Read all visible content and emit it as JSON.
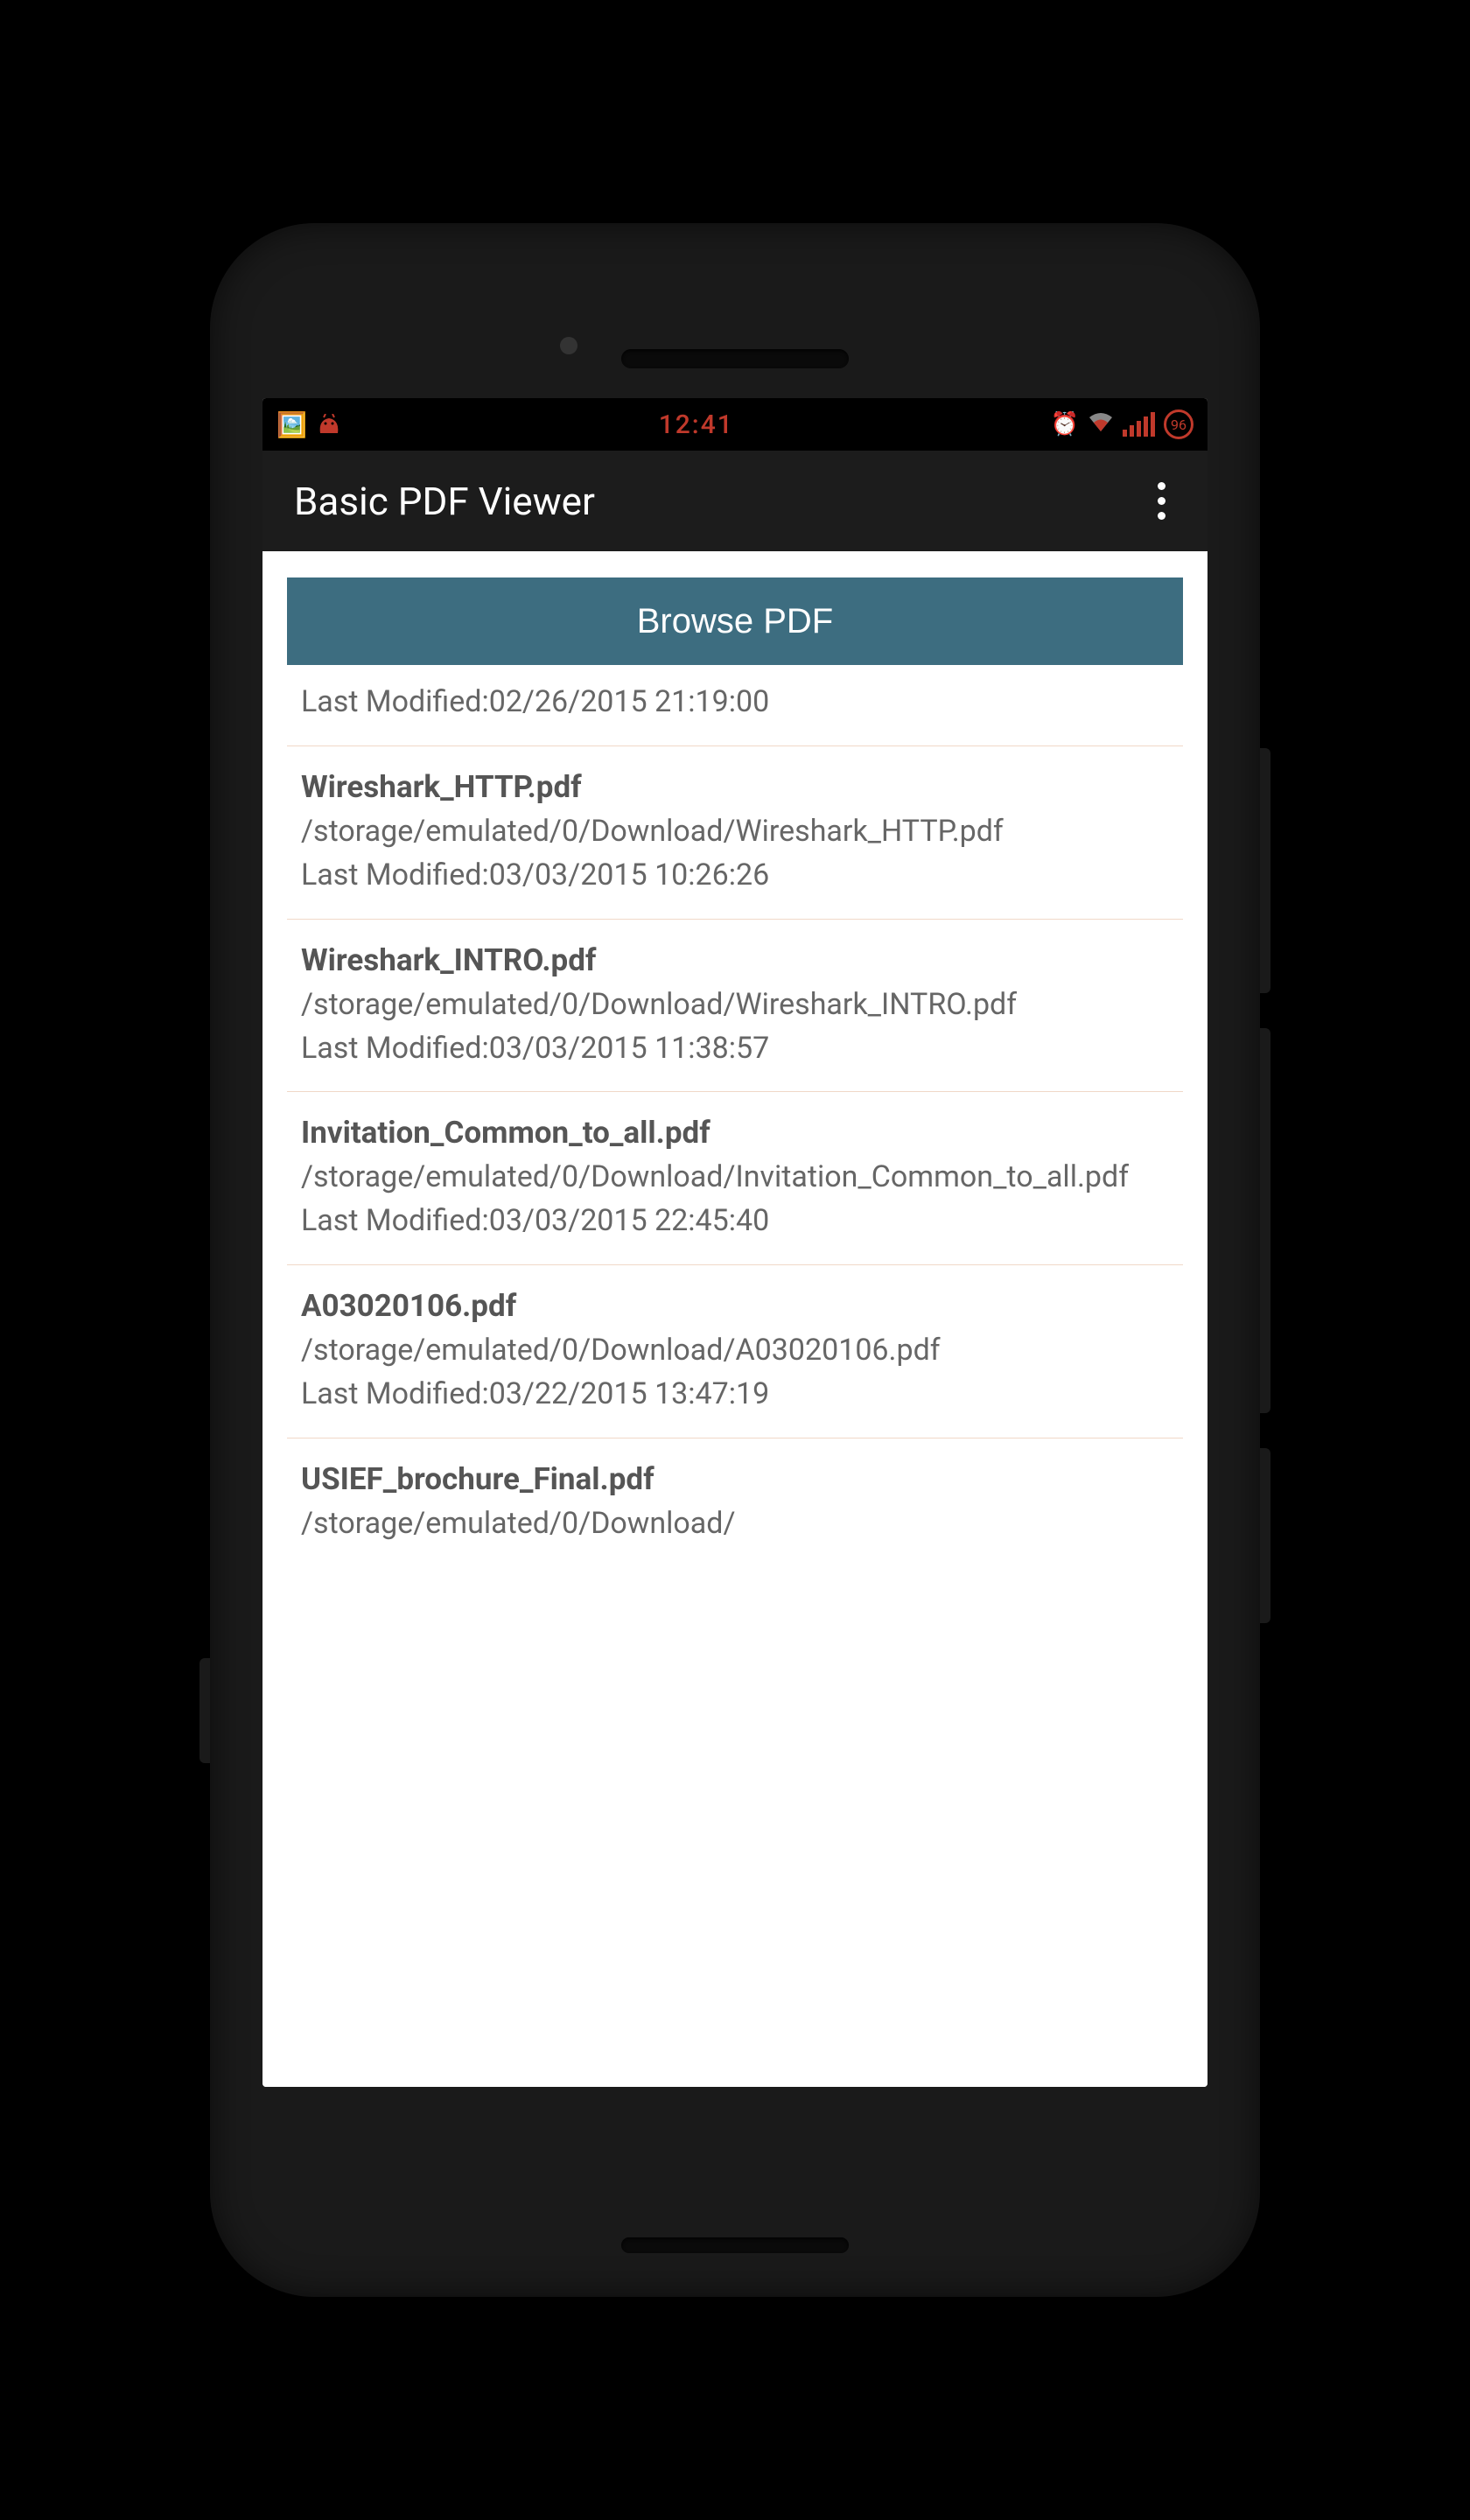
{
  "status": {
    "time": "12:41",
    "battery": "96"
  },
  "header": {
    "title": "Basic PDF Viewer"
  },
  "main": {
    "browse_label": "Browse PDF"
  },
  "files": [
    {
      "modified": "Last Modified:02/26/2015 21:19:00"
    },
    {
      "title": "Wireshark_HTTP.pdf",
      "path": "/storage/emulated/0/Download/Wireshark_HTTP.pdf",
      "modified": "Last Modified:03/03/2015 10:26:26"
    },
    {
      "title": "Wireshark_INTRO.pdf",
      "path": "/storage/emulated/0/Download/Wireshark_INTRO.pdf",
      "modified": "Last Modified:03/03/2015 11:38:57"
    },
    {
      "title": "Invitation_Common_to_all.pdf",
      "path": "/storage/emulated/0/Download/Invitation_Common_to_all.pdf",
      "modified": "Last Modified:03/03/2015 22:45:40"
    },
    {
      "title": "A03020106.pdf",
      "path": "/storage/emulated/0/Download/A03020106.pdf",
      "modified": "Last Modified:03/22/2015 13:47:19"
    },
    {
      "title": "USIEF_brochure_Final.pdf",
      "path": "/storage/emulated/0/Download/"
    }
  ]
}
